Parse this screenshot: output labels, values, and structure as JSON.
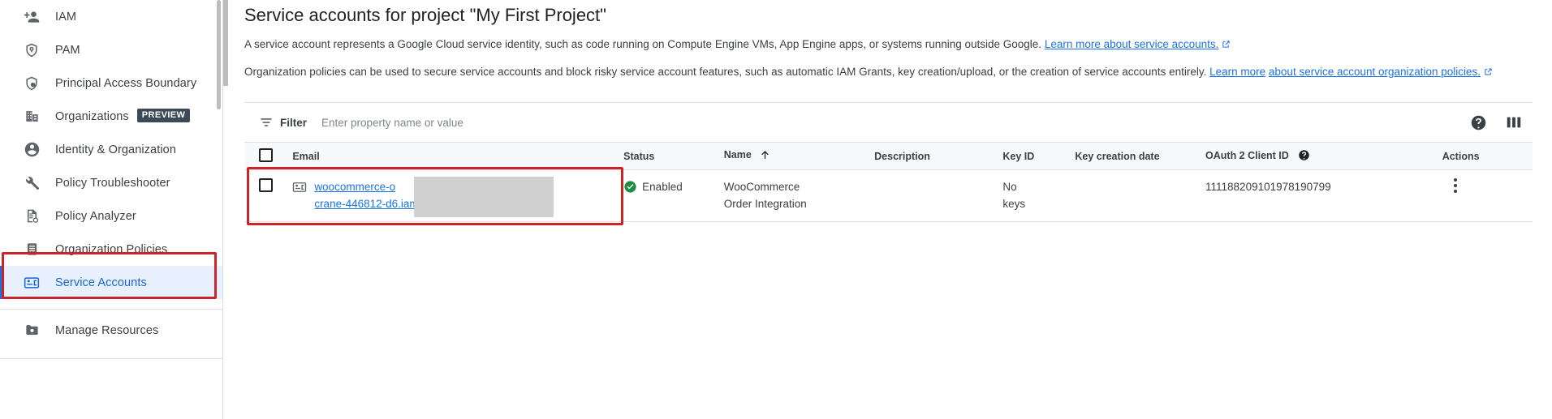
{
  "sidebar": {
    "items": [
      {
        "label": "IAM",
        "icon": "person-add-icon",
        "active": false,
        "badge": ""
      },
      {
        "label": "PAM",
        "icon": "shield-location-icon",
        "active": false,
        "badge": ""
      },
      {
        "label": "Principal Access Boundary",
        "icon": "shield-person-icon",
        "active": false,
        "badge": ""
      },
      {
        "label": "Organizations",
        "icon": "organizations-icon",
        "active": false,
        "badge": "PREVIEW"
      },
      {
        "label": "Identity & Organization",
        "icon": "account-circle-icon",
        "active": false,
        "badge": ""
      },
      {
        "label": "Policy Troubleshooter",
        "icon": "wrench-icon",
        "active": false,
        "badge": ""
      },
      {
        "label": "Policy Analyzer",
        "icon": "document-search-icon",
        "active": false,
        "badge": ""
      },
      {
        "label": "Organization Policies",
        "icon": "list-document-icon",
        "active": false,
        "badge": ""
      },
      {
        "label": "Service Accounts",
        "icon": "service-account-key-icon",
        "active": true,
        "badge": ""
      },
      {
        "label": "Manage Resources",
        "icon": "folder-settings-icon",
        "active": false,
        "badge": ""
      }
    ]
  },
  "page": {
    "title": "Service accounts for project \"My First Project\"",
    "paragraph1_text": "A service account represents a Google Cloud service identity, such as code running on Compute Engine VMs, App Engine apps, or systems running outside Google. ",
    "paragraph1_link": "Learn more about service accounts.",
    "paragraph2_text": "Organization policies can be used to secure service accounts and block risky service account features, such as automatic IAM Grants, key creation/upload, or the creation of service accounts entirely. ",
    "paragraph2_link_a": "Learn more",
    "paragraph2_link_b": "about service account organization policies."
  },
  "toolbar": {
    "filter_label": "Filter",
    "filter_placeholder": "Enter property name or value",
    "help_icon": "help-icon",
    "columns_icon": "column-display-options-icon"
  },
  "table": {
    "columns": [
      "Email",
      "Status",
      "Name",
      "Description",
      "Key ID",
      "Key creation date",
      "OAuth 2 Client ID",
      "Actions"
    ],
    "sorted_column": "Name",
    "sort_direction": "ascending",
    "rows": [
      {
        "email": "woocommerce-o…crane-446812-d6.iam",
        "email_line1": "woocommerce-o",
        "email_line2": "crane-446812-d6.iam",
        "status": "Enabled",
        "name": "WooCommerce Order Integration",
        "name_line1": "WooCommerce",
        "name_line2": "Order Integration",
        "description": "",
        "key_id": "No keys",
        "key_id_line1": "No",
        "key_id_line2": "keys",
        "key_creation_date": "",
        "oauth_client_id": "111188209101978190799",
        "actions_icon": "more-vert-icon"
      }
    ]
  },
  "colors": {
    "accent": "#1a73e8",
    "active_nav_bg": "#e8f0fe",
    "highlight_box": "#cc2229",
    "status_enabled": "#1e8e3e",
    "redaction": "#d0d0d0"
  }
}
